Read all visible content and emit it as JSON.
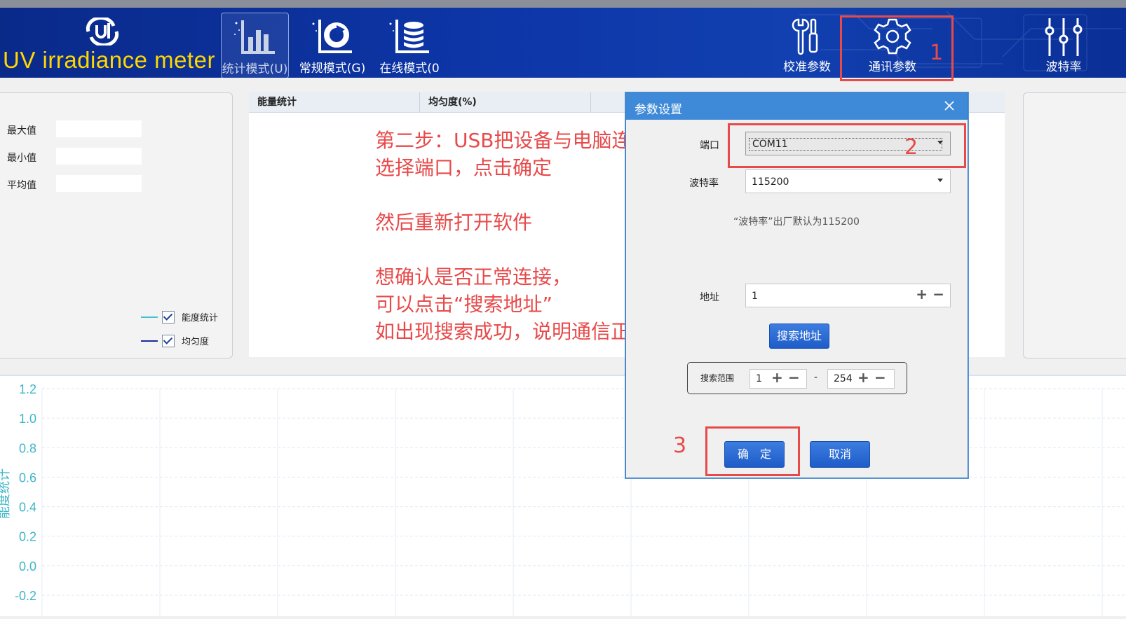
{
  "header": {
    "app_title": "UV irradiance meter",
    "modes": [
      {
        "label": "统计模式(U)",
        "icon": "bar-chart-icon",
        "active": true
      },
      {
        "label": "常规模式(G)",
        "icon": "donut-chart-icon",
        "active": false
      },
      {
        "label": "在线模式(0",
        "icon": "database-icon",
        "active": false
      }
    ],
    "right_buttons": [
      {
        "label": "校准参数",
        "icon": "tools-icon"
      },
      {
        "label": "通讯参数",
        "icon": "gear-icon"
      },
      {
        "label": "波特率",
        "icon": "sliders-icon"
      }
    ],
    "colors": {
      "bar": "#0d36a8",
      "title": "#ffd800"
    }
  },
  "stats": {
    "max_label": "最大值",
    "min_label": "最小值",
    "avg_label": "平均值",
    "legend": [
      {
        "label": "能度统计",
        "color": "#3fc4cf",
        "checked": true
      },
      {
        "label": "均匀度",
        "color": "#1a2aa0",
        "checked": true
      }
    ]
  },
  "table": {
    "columns": [
      "能量统计",
      "均匀度(%)"
    ]
  },
  "instructions": {
    "line1": "第二步：USB把设备与电脑连接后",
    "line2": "选择端口，点击确定",
    "line3": "然后重新打开软件",
    "line4": "想确认是否正常连接，",
    "line5": "可以点击“搜索地址”",
    "line6": "如出现搜索成功，说明通信正常"
  },
  "dialog": {
    "title": "参数设置",
    "port_label": "端口",
    "port_value": "COM11",
    "baud_label": "波特率",
    "baud_value": "115200",
    "baud_hint": "“波特率”出厂默认为115200",
    "address_label": "地址",
    "address_value": "1",
    "search_button": "搜索地址",
    "range_label": "搜索范围",
    "range_from": "1",
    "range_sep": "-",
    "range_to": "254",
    "ok_button": "确　定",
    "cancel_button": "取消"
  },
  "annotations": {
    "step1": "1",
    "step2": "2",
    "step3": "3"
  },
  "chart_data": {
    "type": "line",
    "ylabel": "能度统计",
    "ylim": [
      -0.2,
      1.2
    ],
    "yticks": [
      "1.2",
      "1.0",
      "0.8",
      "0.6",
      "0.4",
      "0.2",
      "0.0",
      "-0.2"
    ],
    "grid": true,
    "series": []
  }
}
